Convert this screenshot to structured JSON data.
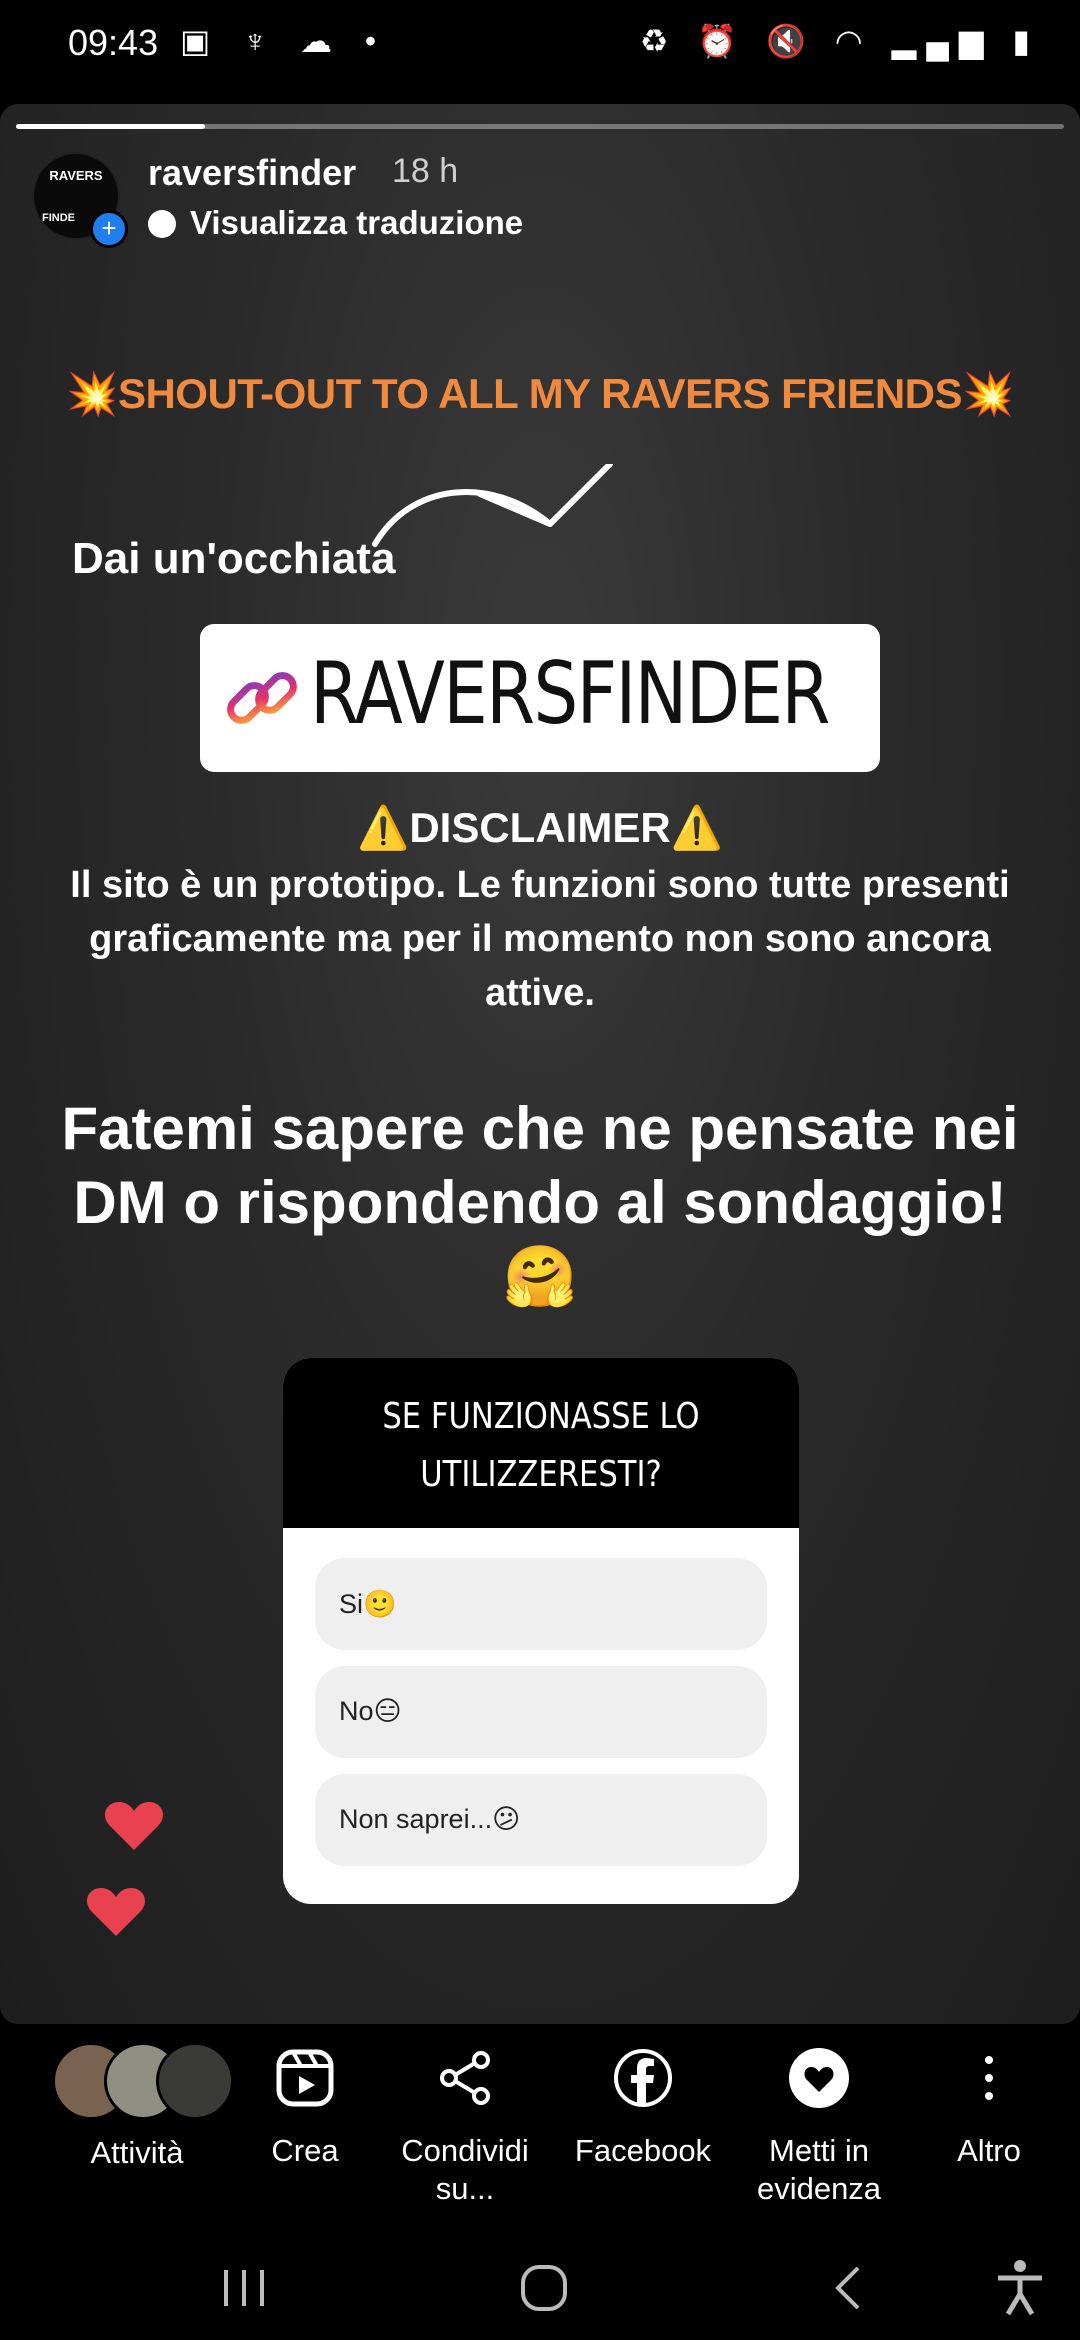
{
  "status": {
    "time": "09:43",
    "left_icons": [
      "image-icon",
      "app-icon",
      "cloud-icon",
      "dot-icon"
    ],
    "right_icons": [
      "battery-saver-icon",
      "alarm-icon",
      "mute-icon",
      "wifi-icon",
      "signal-icon",
      "battery-icon"
    ]
  },
  "story": {
    "progress": 0.18,
    "username": "raversfinder",
    "time_ago": "18 h",
    "translate_label": "Visualizza traduzione",
    "avatar_text_top": "RAVERS",
    "avatar_text_bottom": "FINDE",
    "shoutout": "💥SHOUT-OUT TO ALL MY RAVERS FRIENDS💥",
    "look_label": "Dai un'occhiata",
    "link_sticker_label": "RAVERSFINDER",
    "disclaimer_title": "⚠️DISCLAIMER⚠️",
    "disclaimer_text": "Il sito è un prototipo. Le funzioni sono tutte presenti graficamente ma per il momento non sono ancora attive.",
    "cta_text": "Fatemi sapere che ne pensate nei DM o rispondendo al sondaggio!🤗",
    "poll": {
      "question_line1": "SE FUNZIONASSE LO",
      "question_line2": "UTILIZZERESTI?",
      "options": [
        "Si🙂",
        "No😑",
        "Non saprei...😕"
      ]
    }
  },
  "actions": [
    {
      "label": "Attività",
      "icon": "activity-avatars"
    },
    {
      "label": "Crea",
      "icon": "reels-icon"
    },
    {
      "label": "Condividi su...",
      "icon": "share-icon"
    },
    {
      "label": "Facebook",
      "icon": "facebook-icon"
    },
    {
      "label": "Metti in evidenza",
      "icon": "highlight-heart-icon"
    },
    {
      "label": "Altro",
      "icon": "more-vertical-icon"
    }
  ],
  "colors": {
    "shoutout": "#f08a3e",
    "heart": "#e8414f",
    "avatar_badge": "#1f7ff0"
  }
}
